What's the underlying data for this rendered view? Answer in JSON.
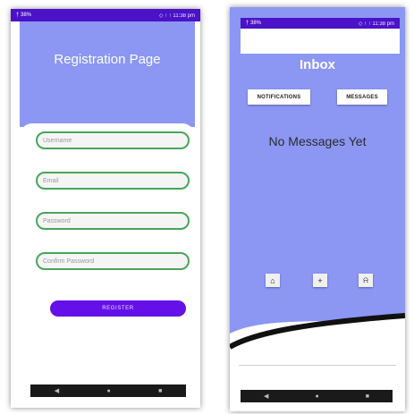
{
  "left_screen": {
    "status_left": "† 38%",
    "status_right": "◇ ↑ ↑ 11:38 pm",
    "title": "Registration Page",
    "fields": [
      {
        "placeholder": "Username"
      },
      {
        "placeholder": "Email"
      },
      {
        "placeholder": "Password"
      },
      {
        "placeholder": "Confirm Password"
      }
    ],
    "register_label": "REGISTER",
    "nav": [
      "◀",
      "●",
      "■"
    ]
  },
  "right_screen": {
    "status_left": "† 38%",
    "status_right": "◇ ↑ ↑ 11:38 pm",
    "title": "Inbox",
    "tab_notifications": "NOTIFICATIONS",
    "tab_messages": "MESSAGES",
    "empty_text": "No Messages Yet",
    "home_glyph": "⌂",
    "plus_glyph": "+",
    "bell_glyph": "⍾",
    "nav": [
      "◀",
      "●",
      "■"
    ]
  },
  "colors": {
    "header_blue": "#8b97f3",
    "status_purple": "#4b12c8",
    "button_purple": "#6510e8",
    "field_border_green": "#49a55b"
  },
  "icons": [
    "home-icon",
    "plus-icon",
    "bell-icon",
    "back-icon",
    "home-nav-icon",
    "recents-icon"
  ]
}
